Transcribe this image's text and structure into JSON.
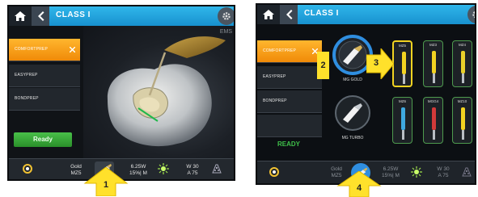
{
  "left_screen": {
    "title": "CLASS I",
    "watermark": "EMS",
    "menu": [
      {
        "label": "COMFORTPREP",
        "active": true
      },
      {
        "label": "EASYPREP",
        "active": false
      },
      {
        "label": "BONDPREP",
        "active": false
      }
    ],
    "ready_label": "Ready",
    "status": {
      "instrument": "Gold\nMZ5",
      "power": "6.25W\n15%| M",
      "water": "W 30\nA 75"
    },
    "callout": "1"
  },
  "right_screen": {
    "title": "CLASS I",
    "menu": [
      {
        "label": "COMFORTPREP",
        "active": true
      },
      {
        "label": "EASYPREP",
        "active": false
      },
      {
        "label": "BONDPREP",
        "active": false
      }
    ],
    "handpieces": [
      {
        "label": "MG GOLD"
      },
      {
        "label": "MG TURBO"
      }
    ],
    "tools": [
      {
        "label": "MZ5",
        "color": "#f2d321",
        "selected": true
      },
      {
        "label": "MZ3",
        "color": "#f2d321",
        "selected": false
      },
      {
        "label": "MZ4",
        "color": "#e8cf2a",
        "selected": false
      },
      {
        "label": "MZ6",
        "color": "#3fa9e0",
        "selected": false
      },
      {
        "label": "MGG4",
        "color": "#d23a3a",
        "selected": false
      },
      {
        "label": "MZ10",
        "color": "#f2d321",
        "selected": false
      }
    ],
    "ready_label": "READY",
    "status": {
      "instrument": "Gold\nMZ5",
      "power": "6.25W\n15%| M",
      "water": "W 30\nA 75"
    },
    "callouts": [
      "2",
      "3",
      "4"
    ]
  },
  "colors": {
    "topbar": "#1891cf",
    "accent_orange": "#f08a08",
    "ready_green": "#2f9f2f",
    "callout_yellow": "#ffe12b",
    "halo_blue": "#2f8ee0"
  }
}
